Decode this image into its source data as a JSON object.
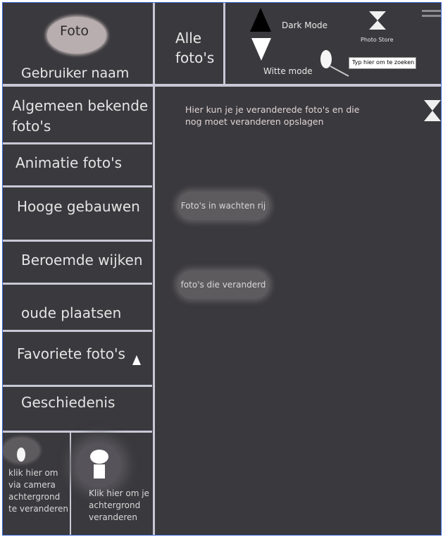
{
  "header": {
    "avatar_label": "Foto",
    "user_name": "Gebruiker naam",
    "all_photos": "Alle foto's",
    "dark_mode": "Dark Mode",
    "white_mode": "Witte mode",
    "photo_store": "Photo Store",
    "search_placeholder": "Typ hier om te zoeken"
  },
  "sidebar": {
    "items": [
      {
        "label": "Algemeen bekende foto's"
      },
      {
        "label": "Animatie foto's"
      },
      {
        "label": "Hooge gebauwen"
      },
      {
        "label": "Beroemde wijken"
      },
      {
        "label": "oude plaatsen"
      },
      {
        "label": "Favoriete foto's"
      },
      {
        "label": "Geschiedenis"
      }
    ],
    "camera_text": "klik hier om via camera achtergrond te veranderen",
    "background_text": "Klik hier om je achtergrond veranderen"
  },
  "main": {
    "info_text": "Hier kun je je veranderede foto's en die nog moet veranderen opslagen",
    "queue_button": "Foto's in wachten rij",
    "changed_button": "foto's die veranderd"
  },
  "colors": {
    "background": "#3a393d",
    "divider": "#c8c8d6",
    "pill": "#5e5b5e",
    "avatar": "#b9aeaf"
  }
}
